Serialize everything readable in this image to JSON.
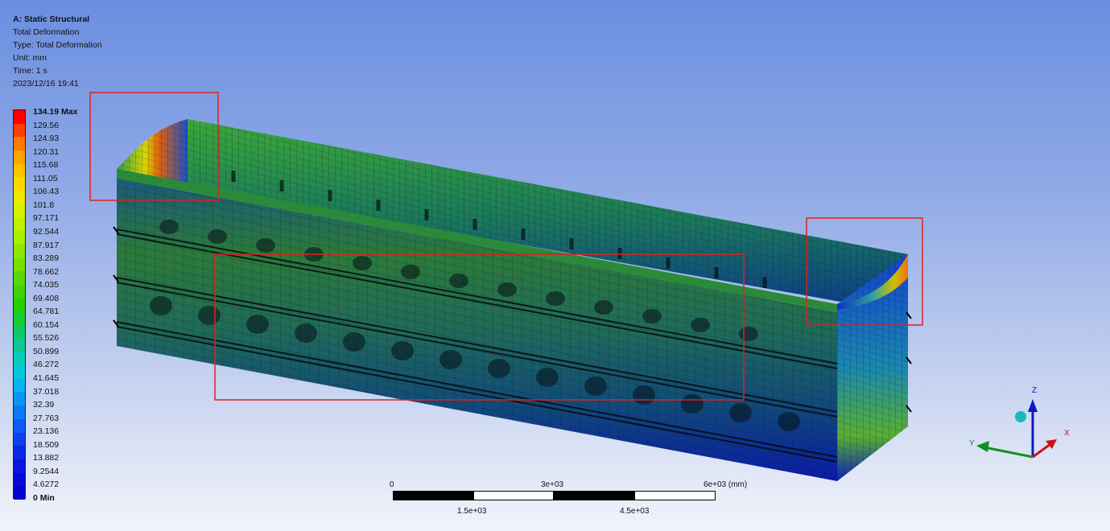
{
  "header": {
    "title": "A: Static Structural",
    "result": "Total Deformation",
    "type": "Type: Total Deformation",
    "unit": "Unit: mm",
    "time": "Time: 1 s",
    "date": "2023/12/16 19:41"
  },
  "legend": {
    "labels": [
      "134.19 Max",
      "129.56",
      "124.93",
      "120.31",
      "115.68",
      "111.05",
      "106.43",
      "101.8",
      "97.171",
      "92.544",
      "87.917",
      "83.289",
      "78.662",
      "74.035",
      "69.408",
      "64.781",
      "60.154",
      "55.526",
      "50.899",
      "46.272",
      "41.645",
      "37.018",
      "32.39",
      "27.763",
      "23.136",
      "18.509",
      "13.882",
      "9.2544",
      "4.6272",
      "0 Min"
    ],
    "colors": [
      "#ff0000",
      "#ff3d00",
      "#ff7a00",
      "#ffa500",
      "#ffc300",
      "#ffd800",
      "#f0e800",
      "#d8f000",
      "#c0f000",
      "#a8f000",
      "#8ee800",
      "#74e000",
      "#5ad800",
      "#40d400",
      "#26d000",
      "#18cc30",
      "#12c864",
      "#0ec892",
      "#0acbbe",
      "#06c8dc",
      "#06b4f0",
      "#0a96f5",
      "#0c78f5",
      "#0e5af5",
      "#0c40f0",
      "#0a28e8",
      "#0814e0",
      "#0608d8",
      "#0400d0"
    ]
  },
  "scale_bar": {
    "top_labels": [
      "0",
      "3e+03",
      "6e+03 (mm)"
    ],
    "bottom_labels": [
      "1.5e+03",
      "4.5e+03"
    ]
  },
  "triad": {
    "z": "Z",
    "y": "Y",
    "x": "X"
  }
}
